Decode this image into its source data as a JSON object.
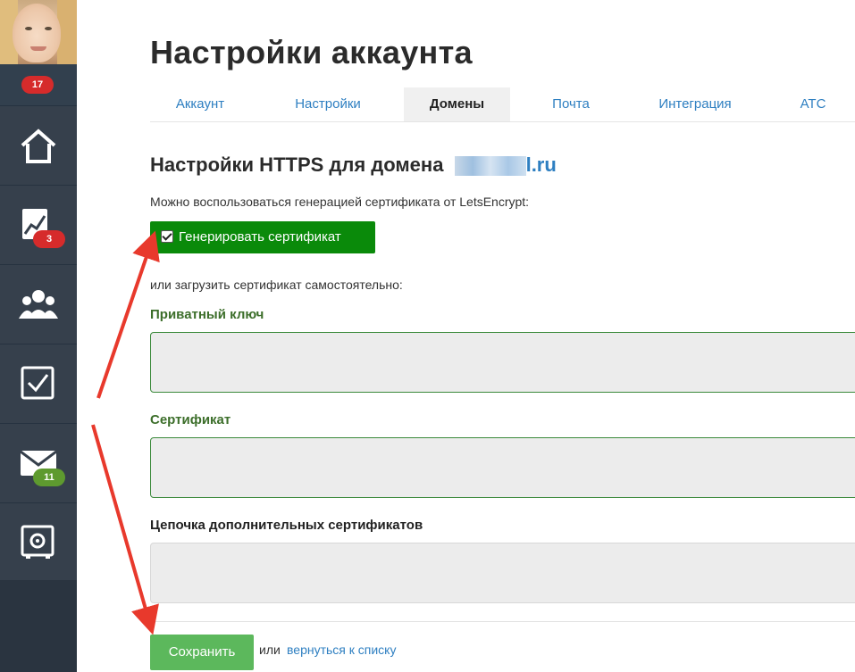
{
  "sidebar": {
    "top_badge": "17",
    "items": [
      {
        "icon": "home-icon"
      },
      {
        "icon": "chart-icon",
        "badge": "3",
        "badge_color": "#d62b2b"
      },
      {
        "icon": "people-icon"
      },
      {
        "icon": "checkbox-icon"
      },
      {
        "icon": "mail-icon",
        "badge": "11",
        "badge_color": "#5e9a2f"
      },
      {
        "icon": "safe-icon"
      }
    ]
  },
  "page": {
    "title": "Настройки аккаунта"
  },
  "tabs": [
    {
      "label": "Аккаунт"
    },
    {
      "label": "Настройки"
    },
    {
      "label": "Домены",
      "active": true
    },
    {
      "label": "Почта"
    },
    {
      "label": "Интеграция"
    },
    {
      "label": "АТС"
    }
  ],
  "https": {
    "title_prefix": "Настройки HTTPS для домена",
    "domain_suffix": "l.ru",
    "hint": "Можно воспользоваться генерацией сертификата от LetsEncrypt:",
    "generate_label": "Генерировать сертификат",
    "generate_checked": true,
    "or_upload": "или загрузить сертификат самостоятельно:"
  },
  "fields": {
    "private_key_label": "Приватный ключ",
    "certificate_label": "Сертификат",
    "chain_label": "Цепочка дополнительных сертификатов"
  },
  "footer": {
    "save_label": "Сохранить",
    "or_text": "или",
    "back_link": "вернуться к списку"
  },
  "colors": {
    "sidebar_bg": "#32404e",
    "accent_link": "#2e7fc1",
    "generate_bg": "#0a8a0a",
    "save_bg": "#5cb85c",
    "field_label_green": "#3c6e2a",
    "annotation_arrow": "#e8392c"
  }
}
